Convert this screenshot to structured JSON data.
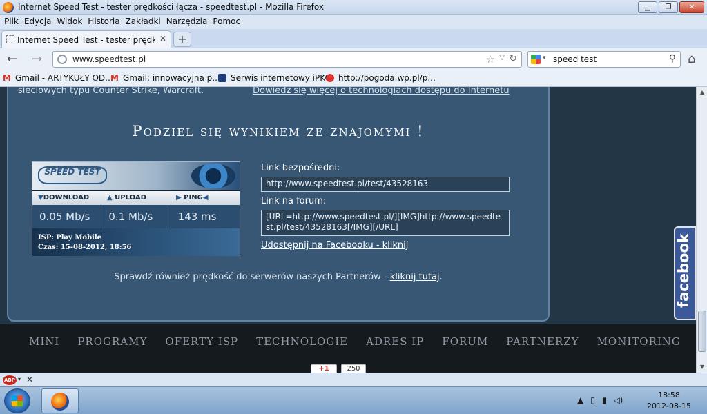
{
  "window": {
    "title": "Internet Speed Test - tester prędkości łącza - speedtest.pl - Mozilla Firefox",
    "controls": {
      "minimize": "▁",
      "maximize": "❐",
      "close": "✕"
    }
  },
  "menu": [
    "Plik",
    "Edycja",
    "Widok",
    "Historia",
    "Zakładki",
    "Narzędzia",
    "Pomoc"
  ],
  "tabs": [
    {
      "label": "Internet Speed Test - tester prędkości łąc...",
      "close": "✕"
    }
  ],
  "new_tab": "+",
  "nav": {
    "back": "←",
    "forward": "→",
    "url": "www.speedtest.pl",
    "search_value": "speed test",
    "star": "☆",
    "dropdown": "▽",
    "reload": "↻",
    "search_icon": "⚲",
    "home": "⌂"
  },
  "bookmarks": [
    {
      "label": "Gmail - ARTYKUŁY OD...",
      "icon": "gmail-icon"
    },
    {
      "label": "Gmail: innowacyjna p...",
      "icon": "gmail-icon"
    },
    {
      "label": "Serwis internetowy iPKO",
      "icon": "pko-icon"
    },
    {
      "label": "http://pogoda.wp.pl/p...",
      "icon": "weather-icon"
    }
  ],
  "content": {
    "top_left_text": "sieciowych typu Counter Strike, Warcraft.",
    "top_right_link": "Dowiedz się więcej o technologiach dostępu do Internetu",
    "share_heading": "Podziel się wynikiem ze znajomymi !",
    "result_card": {
      "logo": "SPEED TEST",
      "labels": {
        "download": "DOWNLOAD",
        "upload": "UPLOAD",
        "ping": "PING"
      },
      "values": {
        "download": "0.05 Mb/s",
        "upload": "0.1 Mb/s",
        "ping": "143 ms"
      },
      "isp": "ISP: Play Mobile",
      "time": "Czas: 15-08-2012, 18:56"
    },
    "direct_link_label": "Link bezpośredni:",
    "direct_link_value": "http://www.speedtest.pl/test/43528163",
    "forum_link_label": "Link na forum:",
    "forum_link_value": "[URL=http://www.speedtest.pl/][IMG]http://www.speedtest.pl/test/43528163[/IMG][/URL]",
    "facebook_share": "Udostępnij na Facebooku - kliknij",
    "partners_text": "Sprawdź również prędkość do serwerów naszych Partnerów - ",
    "partners_link": "kliknij tutaj",
    "partners_end": "."
  },
  "footer_nav": [
    "MINI",
    "PROGRAMY",
    "OFERTY ISP",
    "TECHNOLOGIE",
    "ADRES IP",
    "FORUM",
    "PARTNERZY",
    "MONITORING"
  ],
  "social": {
    "gplus": "+1",
    "count": "250"
  },
  "facebook_tab": "facebook",
  "addon_bar": {
    "abp": "ABP",
    "close": "✕"
  },
  "taskbar": {
    "time": "18:58",
    "date": "2012-08-15"
  }
}
